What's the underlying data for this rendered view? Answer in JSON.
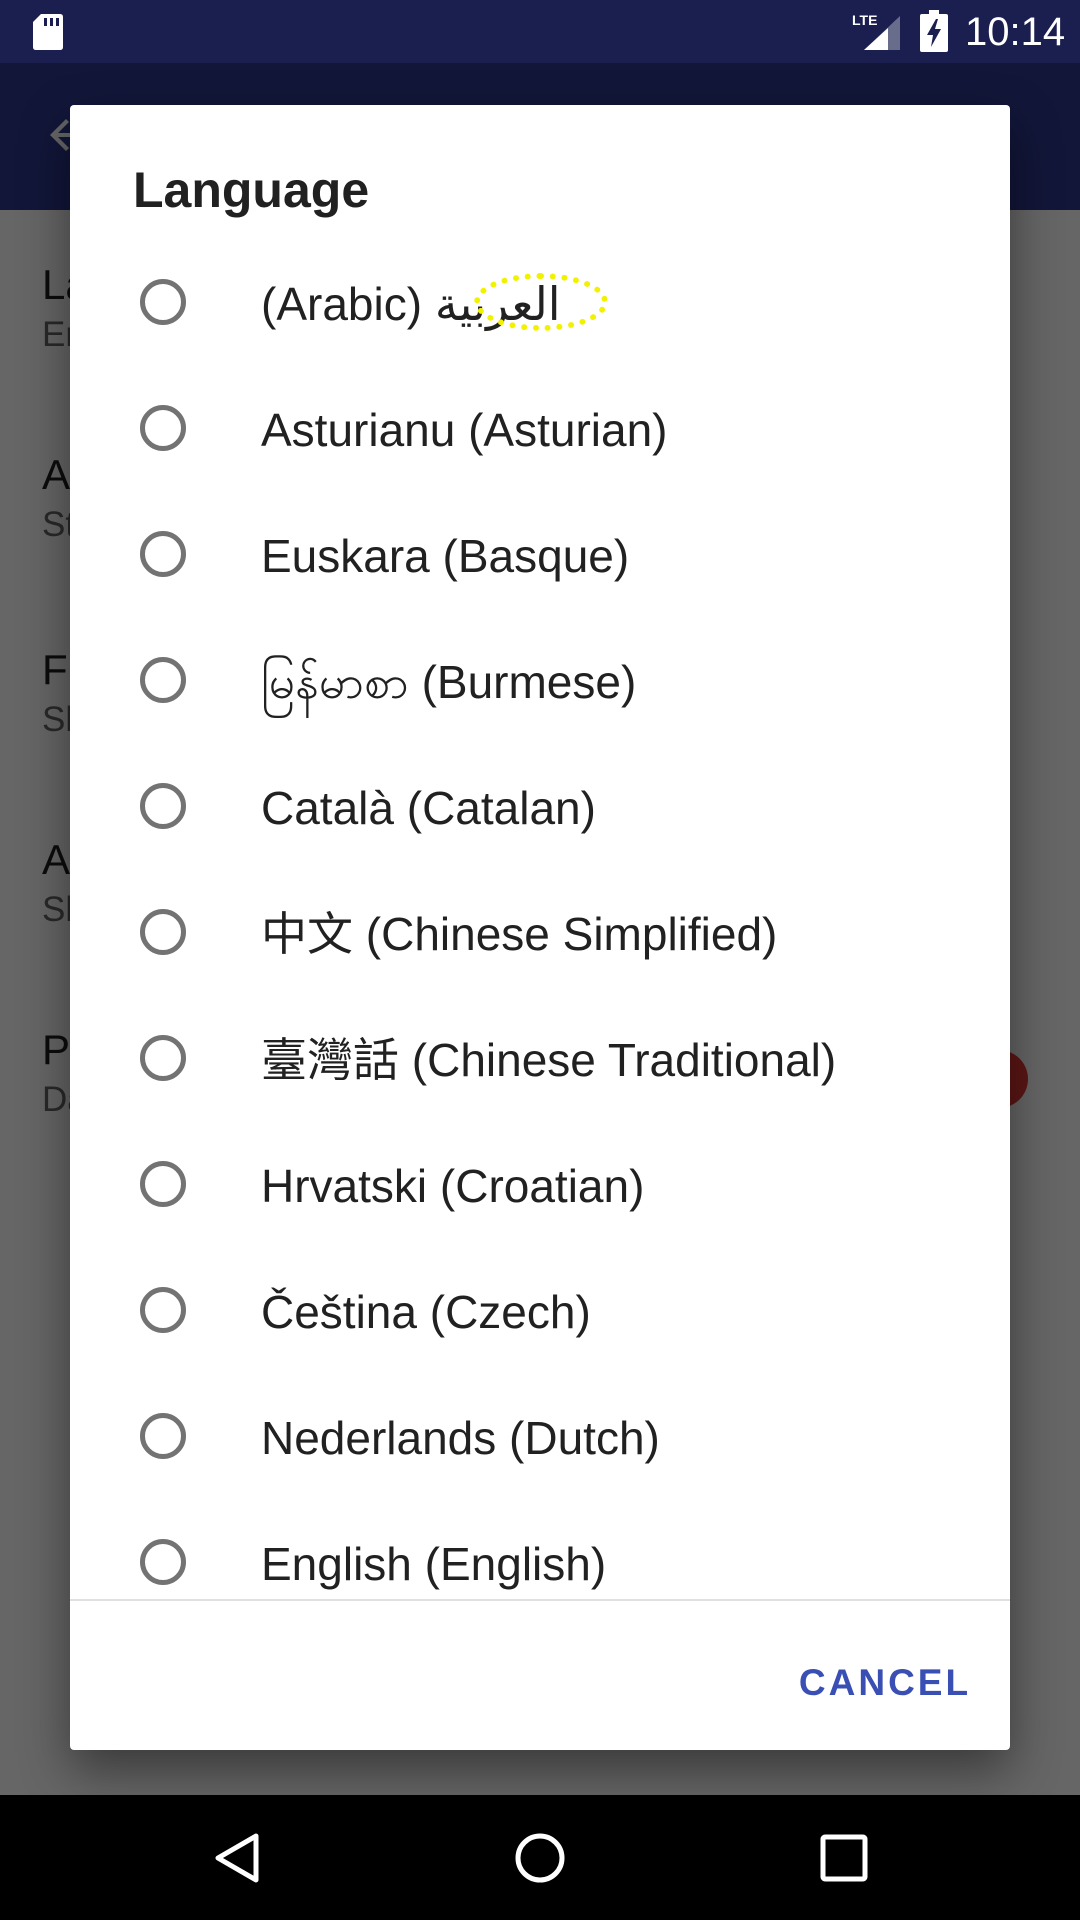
{
  "status_bar": {
    "time": "10:14",
    "network_label": "LTE",
    "icons": [
      "sd-card-icon",
      "lte-signal-icon",
      "battery-charging-icon"
    ]
  },
  "background_settings": {
    "rows": [
      {
        "title": "La",
        "sub": "En"
      },
      {
        "title": "A",
        "sub": "St"
      },
      {
        "title": "Fl",
        "sub": "Sl"
      },
      {
        "title": "A",
        "sub": "Sl"
      },
      {
        "title": "P",
        "sub": "Da"
      }
    ]
  },
  "dialog": {
    "title": "Language",
    "options": [
      {
        "label": "(Arabic) العربية"
      },
      {
        "label": "Asturianu (Asturian)"
      },
      {
        "label": "Euskara (Basque)"
      },
      {
        "label": "မြန်မာစာ (Burmese)"
      },
      {
        "label": "Català (Catalan)"
      },
      {
        "label": "中文 (Chinese Simplified)"
      },
      {
        "label": "臺灣話 (Chinese Traditional)"
      },
      {
        "label": "Hrvatski (Croatian)"
      },
      {
        "label": "Čeština (Czech)"
      },
      {
        "label": "Nederlands (Dutch)"
      },
      {
        "label": "English (English)"
      }
    ],
    "cancel_label": "CANCEL"
  },
  "colors": {
    "status_bar": "#1a1f4f",
    "app_bar": "#2d378f",
    "accent": "#3a4fb3",
    "radio_border": "#737373",
    "highlight": "#f2f200"
  }
}
